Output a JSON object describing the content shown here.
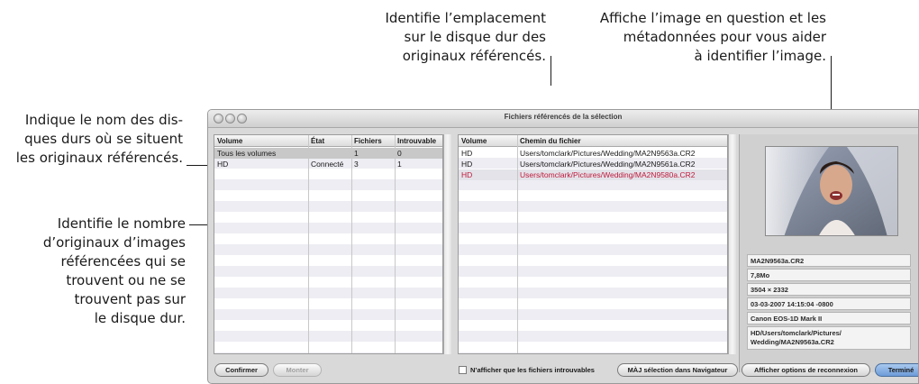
{
  "callouts": {
    "location": [
      "Identifie l’emplacement",
      "sur le disque dur des",
      "originaux référencés."
    ],
    "preview": [
      "Affiche l’image en question et les",
      "métadonnées pour vous aider",
      "à identifier l’image."
    ],
    "disks": [
      "Indique le nom des dis-",
      "ques durs où se situent",
      "les originaux référencés."
    ],
    "count": [
      "Identifie le nombre",
      "d’originaux d’images",
      "référencées qui se",
      "trouvent ou ne se",
      "trouvent pas sur",
      "le disque dur."
    ]
  },
  "window": {
    "title": "Fichiers référencés de la sélection"
  },
  "volumes_table": {
    "headers": [
      "Volume",
      "État",
      "Fichiers",
      "Introuvable"
    ],
    "rows": [
      [
        "Tous les volumes",
        "",
        "1",
        "0"
      ],
      [
        "HD",
        "Connecté",
        "3",
        "1"
      ]
    ]
  },
  "files_table": {
    "headers": [
      "Volume",
      "Chemin du fichier"
    ],
    "rows": [
      [
        "HD",
        "Users/tomclark/Pictures/Wedding/MA2N9563a.CR2"
      ],
      [
        "HD",
        "Users/tomclark/Pictures/Wedding/MA2N9561a.CR2"
      ],
      [
        "HD",
        "Users/tomclark/Pictures/Wedding/MA2N9580a.CR2"
      ]
    ]
  },
  "metadata": {
    "filename": "MA2N9563a.CR2",
    "size": "7,8Mo",
    "dimensions": "3504 × 2332",
    "date": "03-03-2007 14:15:04 -0800",
    "camera": "Canon EOS-1D Mark II",
    "path_line1": "HD/Users/tomclark/Pictures/",
    "path_line2": "Wedding/MA2N9563a.CR2"
  },
  "buttons": {
    "confirm": "Confirmer",
    "show": "Monter",
    "only_missing": "N’afficher que les fichiers introuvables",
    "update_selection": "MÀJ sélection dans Navigateur",
    "reconnect_options": "Afficher options de reconnexion",
    "done": "Terminé"
  },
  "colors": {
    "missing_file": "#c01a3c",
    "default_button": "#6c9bd8"
  }
}
